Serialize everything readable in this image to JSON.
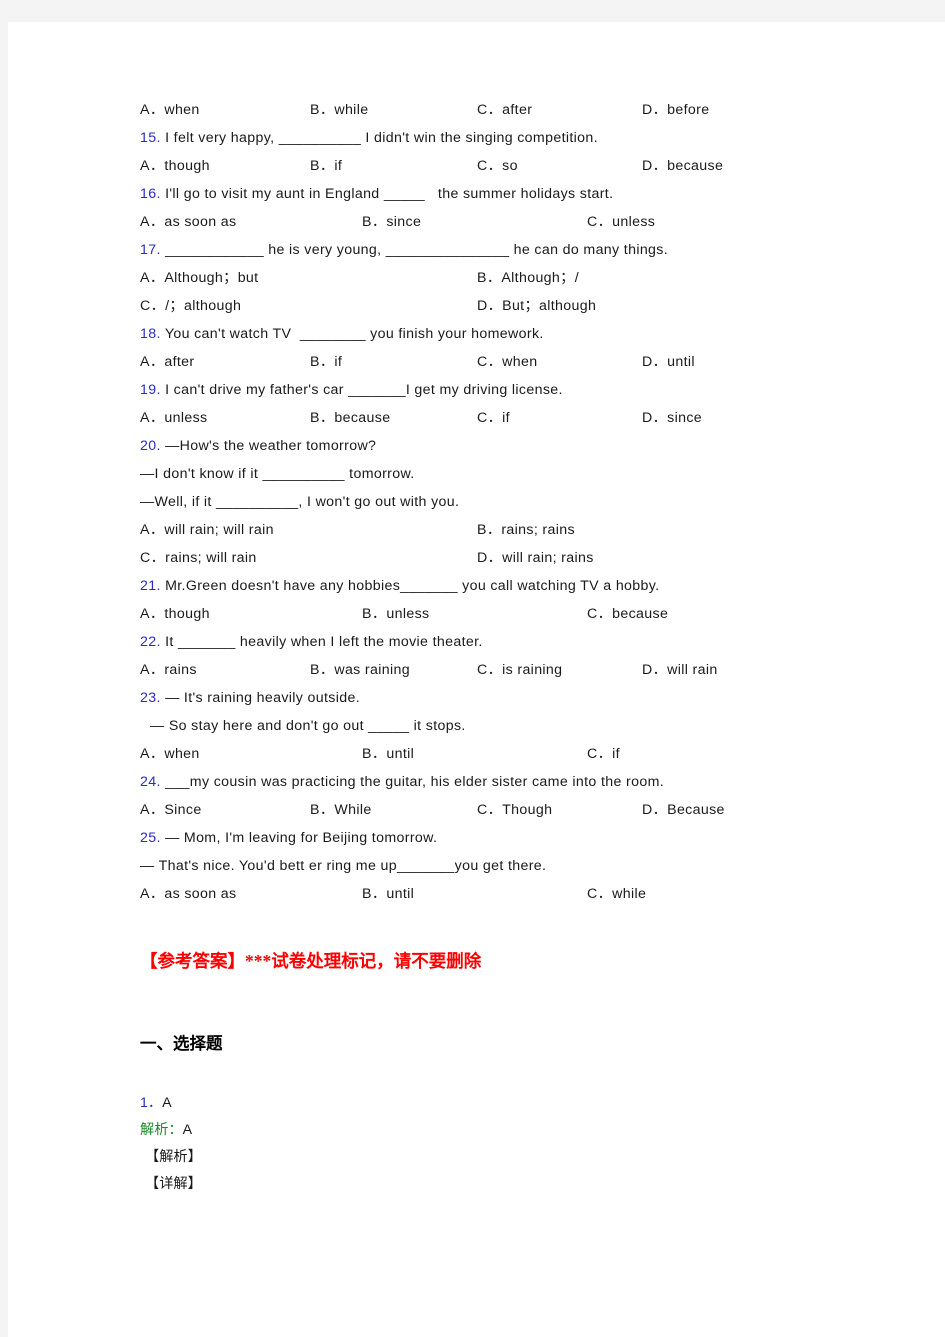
{
  "page": {
    "background": "#f4f4f4",
    "paper": "#ffffff",
    "number_color": "#2b2bc8",
    "marker_color": "#ff0000",
    "analysis_color": "#1a8a28"
  },
  "questions": [
    {
      "id": "q14-options",
      "type": "options4",
      "a": "A．when",
      "b": "B．while",
      "c": "C．after",
      "d": "D．before"
    },
    {
      "id": "q15",
      "type": "stem",
      "num": "15.",
      "text": " I felt very happy, __________ I didn't win the singing competition."
    },
    {
      "id": "q15-options",
      "type": "options4",
      "a": "A．though",
      "b": "B．if",
      "c": "C．so",
      "d": "D．because"
    },
    {
      "id": "q16",
      "type": "stem",
      "num": "16.",
      "text": " I'll go to visit my aunt in England _____   the summer holidays start."
    },
    {
      "id": "q16-options",
      "type": "options3",
      "a": "A．as soon as",
      "b": "B．since",
      "c": "C．unless"
    },
    {
      "id": "q17",
      "type": "stem",
      "num": "17.",
      "text": " ____________ he is very young, _______________ he can do many things."
    },
    {
      "id": "q17-options-1",
      "type": "options2",
      "a": "A．Although；but",
      "b": "B．Although；/"
    },
    {
      "id": "q17-options-2",
      "type": "options2",
      "a": "C．/；although",
      "b": "D．But；although"
    },
    {
      "id": "q18",
      "type": "stem",
      "num": "18.",
      "text": " You can't watch TV  ________ you finish your homework."
    },
    {
      "id": "q18-options",
      "type": "options4",
      "a": "A．after",
      "b": "B．if",
      "c": "C．when",
      "d": "D．until"
    },
    {
      "id": "q19",
      "type": "stem",
      "num": "19.",
      "text": " I can't drive my father's car _______I get my driving license."
    },
    {
      "id": "q19-options",
      "type": "options4",
      "a": "A．unless",
      "b": "B．because",
      "c": "C．if",
      "d": "D．since"
    },
    {
      "id": "q20",
      "type": "stem",
      "num": "20.",
      "text": " —How's the weather tomorrow?"
    },
    {
      "id": "q20-line2",
      "type": "plain",
      "text": "—I don't know if it __________ tomorrow."
    },
    {
      "id": "q20-line3",
      "type": "plain",
      "text": "—Well, if it __________, I won't go out with you."
    },
    {
      "id": "q20-options-1",
      "type": "options2",
      "a": "A．will rain; will rain",
      "b": "B．rains; rains"
    },
    {
      "id": "q20-options-2",
      "type": "options2",
      "a": "C．rains; will rain",
      "b": "D．will rain; rains"
    },
    {
      "id": "q21",
      "type": "stem",
      "num": "21.",
      "text": " Mr.Green doesn't have any hobbies_______ you call watching TV a hobby."
    },
    {
      "id": "q21-options",
      "type": "options3",
      "a": "A．though",
      "b": "B．unless",
      "c": "C．because"
    },
    {
      "id": "q22",
      "type": "stem",
      "num": "22.",
      "text": " It _______ heavily when I left the movie theater."
    },
    {
      "id": "q22-options",
      "type": "options4",
      "a": "A．rains",
      "b": "B．was raining",
      "c": "C．is raining",
      "d": "D．will rain"
    },
    {
      "id": "q23",
      "type": "stem",
      "num": "23.",
      "text": " — It's raining heavily outside."
    },
    {
      "id": "q23-line2",
      "type": "indented",
      "text": "— So stay here and don't go out _____ it stops."
    },
    {
      "id": "q23-options",
      "type": "options3",
      "a": "A．when",
      "b": "B．until",
      "c": "C．if"
    },
    {
      "id": "q24",
      "type": "stem",
      "num": "24.",
      "text": " ___my cousin was practicing the guitar, his elder sister came into the room."
    },
    {
      "id": "q24-options",
      "type": "options4",
      "a": "A．Since",
      "b": "B．While",
      "c": "C．Though",
      "d": "D．Because"
    },
    {
      "id": "q25",
      "type": "stem",
      "num": "25.",
      "text": " — Mom, I'm leaving for Beijing tomorrow."
    },
    {
      "id": "q25-line2",
      "type": "plain",
      "text": "— That's nice. You'd bett er ring me up_______you get there."
    },
    {
      "id": "q25-options",
      "type": "options3",
      "a": "A．as soon as",
      "b": "B．until",
      "c": "C．while"
    }
  ],
  "marker": {
    "text": "【参考答案】***试卷处理标记，请不要删除"
  },
  "answers": {
    "heading": "一、选择题",
    "item_num": "1．",
    "item_value": "A",
    "analysis_label": "解析：",
    "analysis_value": "A",
    "bracket_analysis": "【解析】",
    "bracket_detail": "【详解】"
  }
}
